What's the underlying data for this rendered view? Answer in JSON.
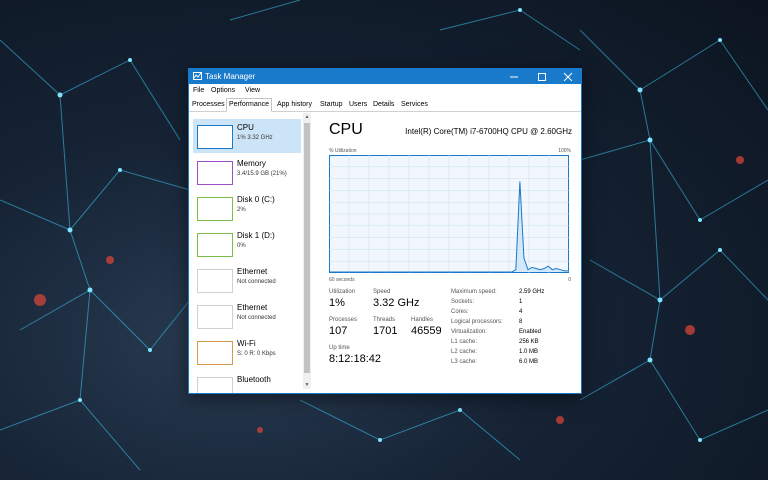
{
  "window": {
    "title": "Task Manager"
  },
  "menu": [
    "File",
    "Options",
    "View"
  ],
  "tabs": [
    "Processes",
    "Performance",
    "App history",
    "Startup",
    "Users",
    "Details",
    "Services"
  ],
  "active_tab": "Performance",
  "sidebar": [
    {
      "label": "CPU",
      "sub": "1% 3.32 GHz",
      "color": "#1979ca",
      "selected": true
    },
    {
      "label": "Memory",
      "sub": "3.4/15.9 GB (21%)",
      "color": "#a04ec6"
    },
    {
      "label": "Disk 0 (C:)",
      "sub": "2%",
      "color": "#7bbf4a"
    },
    {
      "label": "Disk 1 (D:)",
      "sub": "0%",
      "color": "#7bbf4a"
    },
    {
      "label": "Ethernet",
      "sub": "Not connected",
      "color": "#d0d0d0"
    },
    {
      "label": "Ethernet",
      "sub": "Not connected",
      "color": "#d0d0d0"
    },
    {
      "label": "Wi-Fi",
      "sub": "S: 0 R: 0 Kbps",
      "color": "#d89a4c"
    },
    {
      "label": "Bluetooth",
      "sub": "",
      "color": "#d0d0d0"
    }
  ],
  "main": {
    "title": "CPU",
    "model": "Intel(R) Core(TM) i7-6700HQ CPU @ 2.60GHz",
    "graph_top_left": "% Utilization",
    "graph_top_right": "100%",
    "graph_bottom_left": "60 seconds",
    "graph_bottom_right": "0",
    "graph_color": "#1979ca"
  },
  "stats": {
    "utilization_label": "Utilization",
    "utilization": "1%",
    "speed_label": "Speed",
    "speed": "3.32 GHz",
    "processes_label": "Processes",
    "processes": "107",
    "threads_label": "Threads",
    "threads": "1701",
    "handles_label": "Handles",
    "handles": "46559",
    "uptime_label": "Up time",
    "uptime": "8:12:18:42"
  },
  "specs": [
    {
      "label": "Maximum speed:",
      "value": "2.59 GHz"
    },
    {
      "label": "Sockets:",
      "value": "1"
    },
    {
      "label": "Cores:",
      "value": "4"
    },
    {
      "label": "Logical processors:",
      "value": "8"
    },
    {
      "label": "Virtualization:",
      "value": "Enabled"
    },
    {
      "label": "L1 cache:",
      "value": "256 KB"
    },
    {
      "label": "L2 cache:",
      "value": "1.0 MB"
    },
    {
      "label": "L3 cache:",
      "value": "6.0 MB"
    }
  ],
  "cpu_history": [
    0,
    0,
    0,
    0,
    0,
    0,
    0,
    0,
    0,
    0,
    0,
    0,
    0,
    0,
    0,
    0,
    0,
    0,
    0,
    0,
    0,
    0,
    0,
    0,
    0,
    0,
    0,
    0,
    0,
    0,
    0,
    0,
    0,
    0,
    0,
    0,
    0,
    0,
    0,
    0,
    0,
    0,
    0,
    0,
    0,
    0,
    2,
    78,
    12,
    2,
    4,
    3,
    2,
    3,
    5,
    2,
    3,
    2,
    1,
    1
  ]
}
